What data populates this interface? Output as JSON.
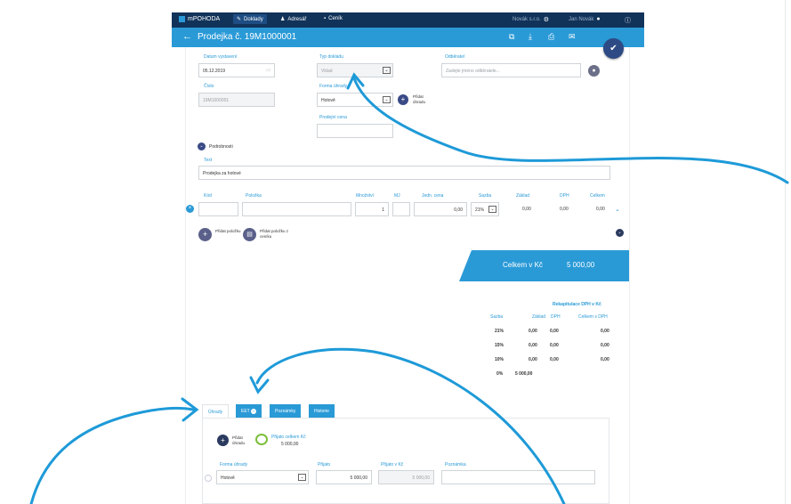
{
  "nav": {
    "brand": "mPOHODA",
    "items": [
      "Doklady",
      "Adresář",
      "Ceník"
    ],
    "company": "Novák s.r.o.",
    "user": "Jan Novák"
  },
  "titlebar": {
    "title": "Prodejka č. 19M1000001"
  },
  "form": {
    "datum_label": "Datum vystavení",
    "datum_value": "05.12.2019",
    "typ_label": "Typ dokladu",
    "typ_value": "Vklad",
    "odberatel_label": "Odběratel",
    "odberatel_placeholder": "Zadejte jméno odběratele...",
    "cislo_label": "Číslo",
    "cislo_value": "19M1000001",
    "forma_label": "Forma úhrady",
    "forma_value": "Hotově",
    "pridat_uhradu": "Přidat úhradu",
    "prodejni_label": "Prodejní cena",
    "podrobnosti": "Podrobnosti",
    "text_label": "Text",
    "text_value": "Prodejka za hotové"
  },
  "items_table": {
    "headers": [
      "Kód",
      "Položka",
      "Množství",
      "MJ",
      "Jedn. cena",
      "Sazba",
      "Základ",
      "DPH",
      "Celkem"
    ],
    "row": {
      "mnozstvi": "1",
      "cena": "0,00",
      "sazba": "21%",
      "zaklad": "0,00",
      "dph": "0,00",
      "celkem": "0,00"
    },
    "add_item": "Přidat položku",
    "add_from_pricelist": "Přidat položku z ceníku"
  },
  "total": {
    "label": "Celkem v Kč",
    "value": "5 000,00"
  },
  "recap": {
    "title": "Rekapitulace DPH v Kč",
    "headers": [
      "Sazba",
      "Základ",
      "DPH",
      "Celkem s DPH"
    ],
    "rows": [
      [
        "21%",
        "0,00",
        "0,00",
        "0,00"
      ],
      [
        "15%",
        "0,00",
        "0,00",
        "0,00"
      ],
      [
        "10%",
        "0,00",
        "0,00",
        "0,00"
      ],
      [
        "0%",
        "5 000,00",
        "",
        ""
      ]
    ]
  },
  "tabs": [
    "Úhrady",
    "EET",
    "Poznámky",
    "Historie"
  ],
  "payments": {
    "add_label": "Přidat úhradu",
    "received_label": "Přijato celkem Kč",
    "received_value": "5 000,00",
    "headers": [
      "Forma úhrady",
      "Přijato",
      "Přijato v Kč",
      "Poznámka"
    ],
    "forma_value": "Hotově",
    "prijato_value": "5 000,00",
    "prijato_kc_value": "5 000,00"
  },
  "colors": {
    "accent": "#2a9ad7",
    "navy": "#11335a",
    "fab": "#2e4a85"
  }
}
